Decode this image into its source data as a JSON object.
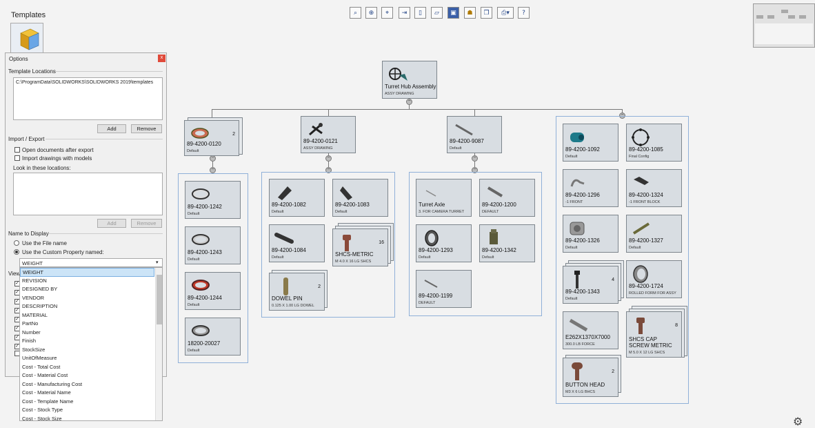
{
  "templates_panel": {
    "title": "Templates"
  },
  "toolbar": {
    "icons": [
      "zoom-to-fit-icon",
      "zoom-in-icon",
      "zoom-area-icon",
      "export-icon",
      "new-document-icon",
      "open-icon",
      "save-icon",
      "hierarchy-icon",
      "copy-icon",
      "print-icon",
      "help-icon"
    ]
  },
  "tree": {
    "root": {
      "name": "Turret Hub Assembly",
      "config": "ASSY DRAWING"
    },
    "level1": [
      {
        "name": "89-4200-0120",
        "config": "Default",
        "qty": "2"
      },
      {
        "name": "89-4200-0121",
        "config": "ASSY DRAWING"
      },
      {
        "name": "89-4200-9087",
        "config": "Default"
      }
    ],
    "group1": [
      {
        "name": "89-4200-1242",
        "config": "Default"
      },
      {
        "name": "89-4200-1243",
        "config": "Default"
      },
      {
        "name": "89-4200-1244",
        "config": "Default"
      },
      {
        "name": "18200-20027",
        "config": "Default"
      }
    ],
    "group2": [
      {
        "name": "89-4200-1082",
        "config": "Default"
      },
      {
        "name": "89-4200-1083",
        "config": "Default"
      },
      {
        "name": "89-4200-1084",
        "config": "Default"
      },
      {
        "name": "SHCS-METRIC",
        "config": "M 4.0 X 16 LG SHCS",
        "qty": "16"
      },
      {
        "name": "DOWEL PIN",
        "config": "0.125 X 1.00 LG DOWEL",
        "qty": "2"
      }
    ],
    "group3": [
      {
        "name": "Turret Axle",
        "config": "3. FOR CAMERA TURRET"
      },
      {
        "name": "89-4200-1200",
        "config": "DEFAULT"
      },
      {
        "name": "89-4200-1293",
        "config": "Default"
      },
      {
        "name": "89-4200-1342",
        "config": "Default"
      },
      {
        "name": "89-4200-1199",
        "config": "DEFAULT"
      }
    ],
    "group4": [
      {
        "name": "89-4200-1092",
        "config": "Default"
      },
      {
        "name": "89-4200-1085",
        "config": "Final Config"
      },
      {
        "name": "89-4200-1296",
        "config": "-1 FRONT"
      },
      {
        "name": "89-4200-1324",
        "config": "-1 FRONT BLOCK"
      },
      {
        "name": "89-4200-1326",
        "config": "Default"
      },
      {
        "name": "89-4200-1327",
        "config": "Default"
      },
      {
        "name": "89-4200-1343",
        "config": "Default",
        "qty": "4"
      },
      {
        "name": "89-4200-1724",
        "config": "ROLLED FORM FOR ASSY"
      },
      {
        "name": "E262X1370X7000",
        "config": "300.0 LB FORCE"
      },
      {
        "name": "SHCS CAP SCREW METRIC",
        "config": "M 5.0 X 12 LG SHCS",
        "qty": "8"
      },
      {
        "name": "BUTTON HEAD",
        "config": "M3 X 6 LG BHCS",
        "qty": "2"
      }
    ]
  },
  "options": {
    "title": "Options",
    "close": "x",
    "template_locations_label": "Template Locations",
    "template_path": "C:\\ProgramData\\SOLIDWORKS\\SOLIDWORKS 2019\\templates",
    "add_label": "Add",
    "remove_label": "Remove",
    "import_export_label": "Import / Export",
    "open_after_export": "Open documents after export",
    "import_drawings": "Import drawings with models",
    "look_in_label": "Look in these locations:",
    "name_to_display_label": "Name to Display",
    "use_file_name": "Use the File name",
    "use_custom_property": "Use the Custom Property named:",
    "selected_property": "WEIGHT",
    "view_label": "View",
    "dropdown_items": [
      "WEIGHT",
      "REVISION",
      "DESIGNED BY",
      "VENDOR",
      "DESCRIPTION",
      "MATERIAL",
      "PartNo",
      "Number",
      "Finish",
      "StockSize",
      "UnitOfMeasure",
      "Cost - Total Cost",
      "Cost - Material Cost",
      "Cost - Manufacturing Cost",
      "Cost - Material Name",
      "Cost - Template Name",
      "Cost - Stock Type",
      "Cost - Stock Size"
    ]
  }
}
